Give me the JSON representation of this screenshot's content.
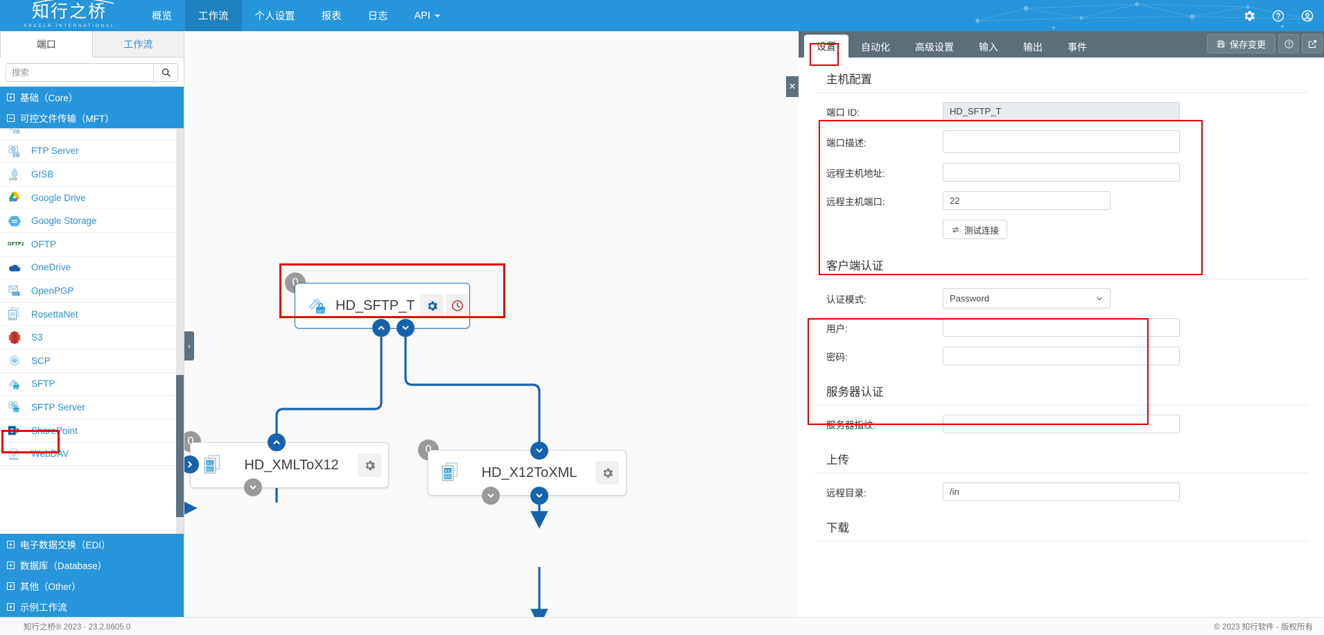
{
  "app": {
    "logo_cn": "知行之桥",
    "logo_en": "ARCELR INTERNATIONAL"
  },
  "topnav": {
    "items": [
      {
        "label": "概览",
        "active": false
      },
      {
        "label": "工作流",
        "active": true
      },
      {
        "label": "个人设置",
        "active": false
      },
      {
        "label": "报表",
        "active": false
      },
      {
        "label": "日志",
        "active": false
      },
      {
        "label": "API",
        "active": false,
        "caret": true
      }
    ],
    "icons": [
      "gear-icon",
      "help-icon",
      "account-icon"
    ]
  },
  "left": {
    "tabs": [
      {
        "label": "端口",
        "active": true
      },
      {
        "label": "工作流",
        "active": false
      }
    ],
    "search": {
      "value": "",
      "placeholder": "搜索"
    },
    "groups_top": [
      {
        "label": "基础（Core）",
        "expanded": false
      },
      {
        "label": "可控文件传输（MFT）",
        "expanded": true
      }
    ],
    "ports": [
      {
        "label": "",
        "icon": "ftp-icon",
        "partial": true
      },
      {
        "label": "FTP Server",
        "icon": "ftp-server-icon"
      },
      {
        "label": "GISB",
        "icon": "gisb-icon"
      },
      {
        "label": "Google Drive",
        "icon": "google-drive-icon"
      },
      {
        "label": "Google Storage",
        "icon": "google-storage-icon"
      },
      {
        "label": "OFTP",
        "icon": "oftp-icon"
      },
      {
        "label": "OneDrive",
        "icon": "onedrive-icon"
      },
      {
        "label": "OpenPGP",
        "icon": "openpgp-icon"
      },
      {
        "label": "RosettaNet",
        "icon": "rosettanet-icon"
      },
      {
        "label": "S3",
        "icon": "s3-icon"
      },
      {
        "label": "SCP",
        "icon": "scp-icon"
      },
      {
        "label": "SFTP",
        "icon": "sftp-icon",
        "highlighted": true
      },
      {
        "label": "SFTP Server",
        "icon": "sftp-server-icon"
      },
      {
        "label": "SharePoint",
        "icon": "sharepoint-icon"
      },
      {
        "label": "WebDAV",
        "icon": "webdav-icon"
      }
    ],
    "groups_bottom": [
      {
        "label": "电子数据交换（EDI）"
      },
      {
        "label": "数据库（Database）"
      },
      {
        "label": "其他（Other）"
      },
      {
        "label": "示例工作流"
      }
    ],
    "collapse_label": "‹"
  },
  "canvas": {
    "close_label": "✕",
    "nodes": [
      {
        "id": "HD_SFTP_T",
        "label": "HD_SFTP_T",
        "badge": "0",
        "icon": "sftp-icon",
        "selected": true,
        "buttons": [
          "gear-icon",
          "clock-icon"
        ]
      },
      {
        "id": "HD_XMLToX12",
        "label": "HD_XMLToX12",
        "badge": "0",
        "icon": "x12-asc-icon",
        "selected": false,
        "buttons": [
          "gear-icon"
        ]
      },
      {
        "id": "HD_X12ToXML",
        "label": "HD_X12ToXML",
        "badge": "0",
        "icon": "x12-asc-icon",
        "selected": false,
        "buttons": [
          "gear-icon"
        ]
      }
    ]
  },
  "right": {
    "tabs": [
      {
        "label": "设置",
        "active": true
      },
      {
        "label": "自动化",
        "active": false
      },
      {
        "label": "高级设置",
        "active": false
      },
      {
        "label": "输入",
        "active": false
      },
      {
        "label": "输出",
        "active": false
      },
      {
        "label": "事件",
        "active": false
      }
    ],
    "save_label": "保存变更",
    "help_label": "?",
    "popout_label": "↗",
    "sections": [
      {
        "title": "主机配置",
        "fields": [
          {
            "label": "端口 ID:",
            "value": "HD_SFTP_T",
            "type": "readonly"
          },
          {
            "label": "端口描述:",
            "value": "",
            "type": "textarea"
          },
          {
            "label": "远程主机地址:",
            "value": "",
            "type": "text"
          },
          {
            "label": "远程主机端口:",
            "value": "22",
            "type": "text-mid"
          }
        ],
        "action": {
          "label": "测试连接",
          "icon": "exchange-icon"
        }
      },
      {
        "title": "客户端认证",
        "fields": [
          {
            "label": "认证模式:",
            "value": "Password",
            "type": "select"
          },
          {
            "label": "用户:",
            "value": "",
            "type": "text"
          },
          {
            "label": "密码:",
            "value": "",
            "type": "text"
          }
        ]
      },
      {
        "title": "服务器认证",
        "fields": [
          {
            "label": "服务器指纹:",
            "value": "",
            "type": "text"
          }
        ]
      },
      {
        "title": "上传",
        "fields": [
          {
            "label": "远程目录:",
            "value": "/in",
            "type": "text"
          }
        ]
      },
      {
        "title": "下载",
        "fields": []
      }
    ]
  },
  "footer": {
    "left": "知行之桥® 2023 - 23.2.8605.0",
    "right": "© 2023 知行软件 - 版权所有"
  },
  "colors": {
    "brand_blue": "#2795d9",
    "nav_active": "#2081bf",
    "panel_gray": "#5d6e77",
    "highlight_red": "#e00000",
    "node_blue": "#1763ab"
  }
}
